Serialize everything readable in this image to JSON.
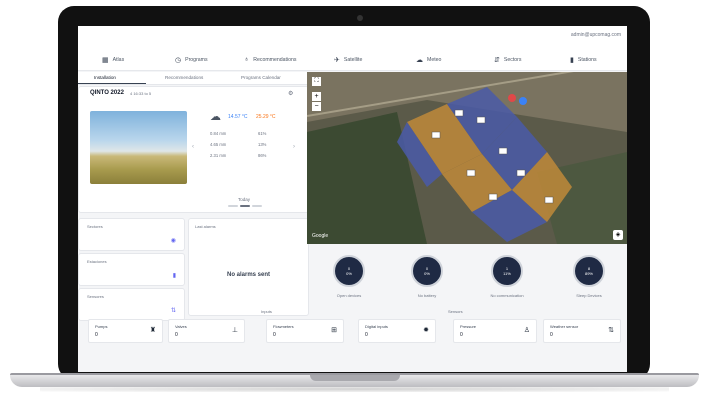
{
  "topbar": {
    "user_email": "admin@upcomag.com"
  },
  "nav": [
    {
      "label": "Atlas",
      "icon": "atlas-icon",
      "glyph": "▦"
    },
    {
      "label": "Programs",
      "icon": "clock-icon",
      "glyph": "◷"
    },
    {
      "label": "Recommendations",
      "icon": "lightbulb-icon",
      "glyph": "♁"
    },
    {
      "label": "Satellite",
      "icon": "satellite-icon",
      "glyph": "✈"
    },
    {
      "label": "Meteo",
      "icon": "weather-icon",
      "glyph": "☁"
    },
    {
      "label": "Sectors",
      "icon": "sectors-icon",
      "glyph": "⇵"
    },
    {
      "label": "Stations",
      "icon": "stations-icon",
      "glyph": "▮"
    }
  ],
  "tabs": [
    "Installation",
    "Recommendations",
    "Programs Calendar"
  ],
  "weather": {
    "title": "QINTO 2022",
    "subtitle": "4 16:33 to 5",
    "temp_min": "14.57 °C",
    "temp_max": "25.29 °C",
    "rows": [
      {
        "icon": "drop-icon",
        "left": "0.84 mm",
        "right": "61%"
      },
      {
        "icon": "evap-icon",
        "left": "4.65 mm",
        "right": "13%"
      },
      {
        "icon": "gauge-icon",
        "left": "2.31 mm",
        "right": "86%"
      }
    ],
    "day_label": "Today"
  },
  "left_cards": [
    {
      "label": "Sectores",
      "icon": "target-icon"
    },
    {
      "label": "Estaciones",
      "icon": "station-icon"
    },
    {
      "label": "Sensores",
      "icon": "sensor-icon"
    }
  ],
  "alarms": {
    "title": "Last alarms",
    "empty_text": "No alarms sent"
  },
  "map": {
    "attribution": "Google"
  },
  "stats": [
    {
      "value": "0",
      "unit": "0%",
      "label": "Open devices"
    },
    {
      "value": "0",
      "unit": "0%",
      "label": "No battery"
    },
    {
      "value": "1",
      "unit": "11%",
      "label": "No communication"
    },
    {
      "value": "8",
      "unit": "89%",
      "label": "Sleep Devices"
    }
  ],
  "sections": {
    "inputs": "Inputs",
    "sensors": "Sensors"
  },
  "sensors": [
    {
      "label": "Pumps",
      "value": "0",
      "icon": "pump-icon",
      "glyph": "♜"
    },
    {
      "label": "Valves",
      "value": "0",
      "icon": "valve-icon",
      "glyph": "⊥"
    },
    {
      "label": "Flowmeters",
      "value": "0",
      "icon": "flowmeter-icon",
      "glyph": "⊞"
    },
    {
      "label": "Digital inputs",
      "value": "0",
      "icon": "digital-icon",
      "glyph": "✹"
    },
    {
      "label": "Pressure",
      "value": "0",
      "icon": "pressure-icon",
      "glyph": "♙"
    },
    {
      "label": "Weather sensor",
      "value": "0",
      "icon": "weather-sensor-icon",
      "glyph": "⇅"
    }
  ]
}
